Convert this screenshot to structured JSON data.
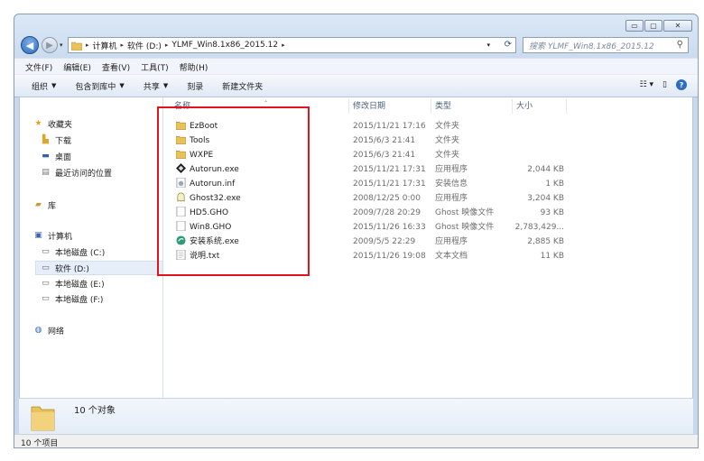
{
  "window_controls": {
    "minimize": "▭",
    "maximize": "▢",
    "close": "✕"
  },
  "address": {
    "crumbs": [
      "计算机",
      "软件 (D:)",
      "YLMF_Win8.1x86_2015.12"
    ],
    "separator": "▸",
    "dropdown": "▾",
    "refresh_icon": "refresh-icon"
  },
  "search": {
    "placeholder": "搜索 YLMF_Win8.1x86_2015.12"
  },
  "menu": [
    "文件(F)",
    "编辑(E)",
    "查看(V)",
    "工具(T)",
    "帮助(H)"
  ],
  "toolbar": {
    "organize": "组织",
    "include_in_library": "包含到库中",
    "share": "共享",
    "burn": "刻录",
    "new_folder": "新建文件夹"
  },
  "sidebar": {
    "favorites": "收藏夹",
    "downloads": "下载",
    "desktop": "桌面",
    "recent": "最近访问的位置",
    "libraries": "库",
    "computer": "计算机",
    "drive_c": "本地磁盘 (C:)",
    "drive_d": "软件 (D:)",
    "drive_e": "本地磁盘 (E:)",
    "drive_f": "本地磁盘 (F:)",
    "network": "网络"
  },
  "columns": {
    "name": "名称",
    "date": "修改日期",
    "type": "类型",
    "size": "大小"
  },
  "files": [
    {
      "name": "EzBoot",
      "date": "2015/11/21 17:16",
      "type": "文件夹",
      "size": "",
      "icon": "folder-icon"
    },
    {
      "name": "Tools",
      "date": "2015/6/3 21:41",
      "type": "文件夹",
      "size": "",
      "icon": "folder-icon"
    },
    {
      "name": "WXPE",
      "date": "2015/6/3 21:41",
      "type": "文件夹",
      "size": "",
      "icon": "folder-icon"
    },
    {
      "name": "Autorun.exe",
      "date": "2015/11/21 17:31",
      "type": "应用程序",
      "size": "2,044 KB",
      "icon": "autorun-exe-icon"
    },
    {
      "name": "Autorun.inf",
      "date": "2015/11/21 17:31",
      "type": "安装信息",
      "size": "1 KB",
      "icon": "inf-file-icon"
    },
    {
      "name": "Ghost32.exe",
      "date": "2008/12/25 0:00",
      "type": "应用程序",
      "size": "3,204 KB",
      "icon": "ghost-exe-icon"
    },
    {
      "name": "HD5.GHO",
      "date": "2009/7/28 20:29",
      "type": "Ghost 映像文件",
      "size": "93 KB",
      "icon": "gho-file-icon"
    },
    {
      "name": "Win8.GHO",
      "date": "2015/11/26 16:33",
      "type": "Ghost 映像文件",
      "size": "2,783,429...",
      "icon": "gho-file-icon"
    },
    {
      "name": "安装系统.exe",
      "date": "2009/5/5 22:29",
      "type": "应用程序",
      "size": "2,885 KB",
      "icon": "install-exe-icon"
    },
    {
      "name": "说明.txt",
      "date": "2015/11/26 19:08",
      "type": "文本文档",
      "size": "11 KB",
      "icon": "txt-file-icon"
    }
  ],
  "details": {
    "count_text": "10 个对象"
  },
  "status": {
    "items_text": "10 个项目"
  }
}
